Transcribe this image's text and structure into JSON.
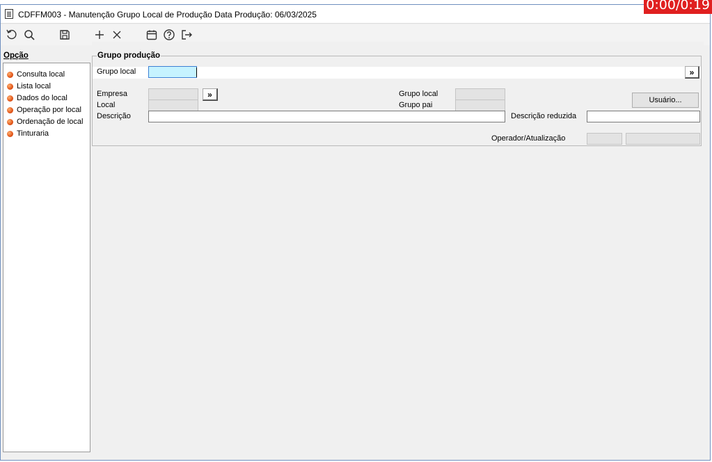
{
  "window": {
    "title": "CDFFM003 - Manutenção Grupo Local de Produção Data Produção: 06/03/2025",
    "timer": "0:00/0:19"
  },
  "toolbar": {
    "icons": [
      "refresh-icon",
      "search-icon",
      "save-icon",
      "add-icon",
      "delete-icon",
      "calendar-icon",
      "help-icon",
      "exit-icon"
    ]
  },
  "sidebar": {
    "header": "Opção",
    "items": [
      {
        "label": "Consulta local"
      },
      {
        "label": "Lista local"
      },
      {
        "label": "Dados do local"
      },
      {
        "label": "Operação por local"
      },
      {
        "label": "Ordenação de local"
      },
      {
        "label": "Tinturaria"
      }
    ]
  },
  "form": {
    "group_title": "Grupo produção",
    "grupo_local_label": "Grupo local",
    "grupo_local_value": "",
    "lookup_label": "»",
    "empresa_label": "Empresa",
    "local_label": "Local",
    "descricao_label": "Descrição",
    "grupo_local_right_label": "Grupo local",
    "grupo_pai_label": "Grupo pai",
    "descricao_reduzida_label": "Descrição reduzida",
    "operador_label": "Operador/Atualização",
    "usuario_button": "Usuário..."
  },
  "colors": {
    "active_field": "#c6f3ff",
    "bullet": "#e2561a",
    "timer_bg": "#e02020"
  }
}
